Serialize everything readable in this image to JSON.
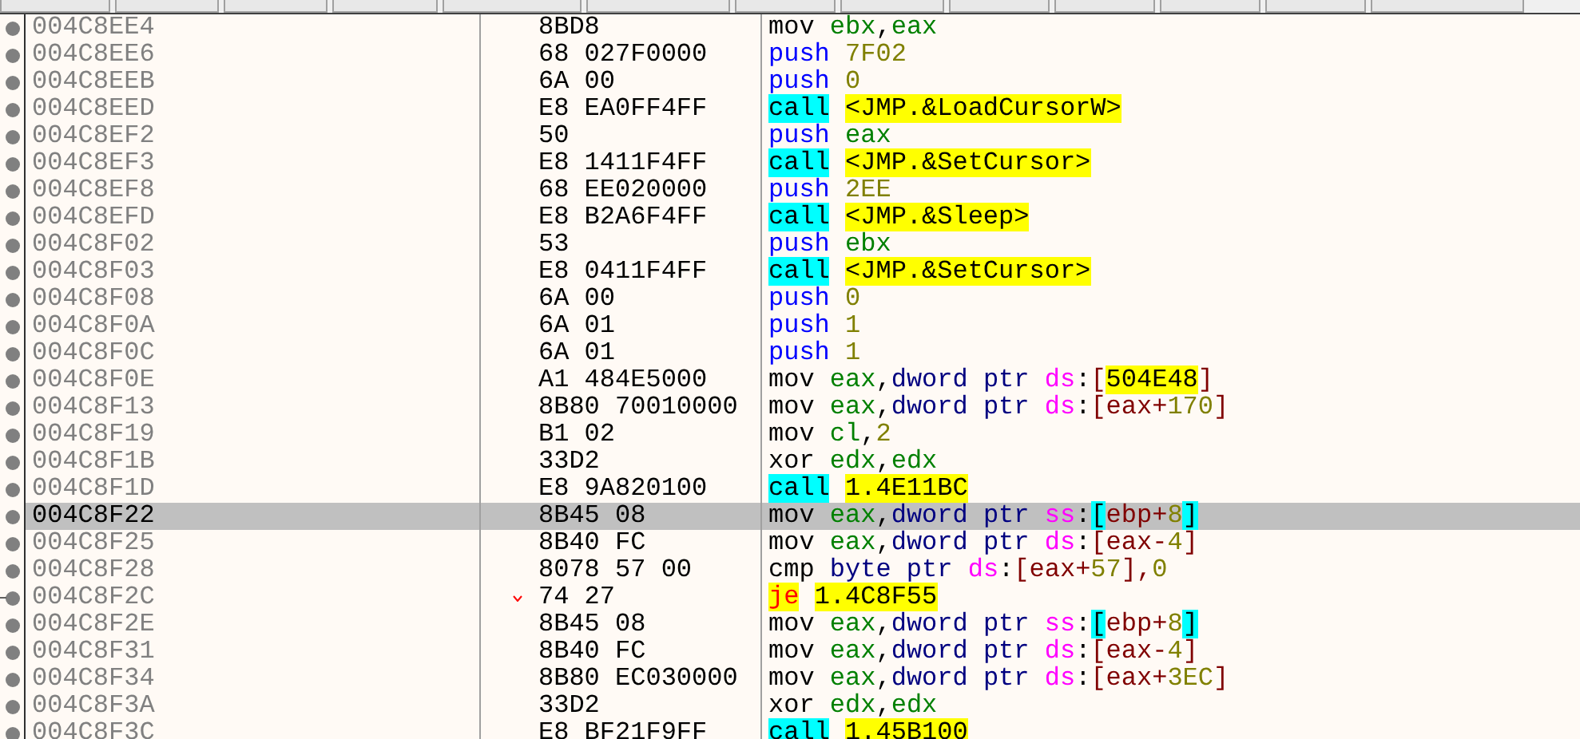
{
  "rows": [
    {
      "address": "004C8EE4",
      "bytes": "8BD8",
      "selected": false,
      "branch": false,
      "ins": [
        {
          "t": "mov",
          "kind": "mnem"
        },
        {
          "t": "ebx",
          "kind": "reg"
        },
        {
          "t": ",",
          "kind": "punct"
        },
        {
          "t": "eax",
          "kind": "reg"
        }
      ]
    },
    {
      "address": "004C8EE6",
      "bytes": "68 027F0000",
      "selected": false,
      "branch": false,
      "ins": [
        {
          "t": "push",
          "kind": "push"
        },
        {
          "t": "7F02",
          "kind": "num"
        }
      ]
    },
    {
      "address": "004C8EEB",
      "bytes": "6A 00",
      "selected": false,
      "branch": false,
      "ins": [
        {
          "t": "push",
          "kind": "push"
        },
        {
          "t": "0",
          "kind": "num"
        }
      ]
    },
    {
      "address": "004C8EED",
      "bytes": "E8 EA0FF4FF",
      "selected": false,
      "branch": false,
      "ins": [
        {
          "t": "call",
          "kind": "call"
        },
        {
          "t": "<JMP.&LoadCursorW>",
          "kind": "target"
        }
      ]
    },
    {
      "address": "004C8EF2",
      "bytes": "50",
      "selected": false,
      "branch": false,
      "ins": [
        {
          "t": "push",
          "kind": "push"
        },
        {
          "t": "eax",
          "kind": "reg"
        }
      ]
    },
    {
      "address": "004C8EF3",
      "bytes": "E8 1411F4FF",
      "selected": false,
      "branch": false,
      "ins": [
        {
          "t": "call",
          "kind": "call"
        },
        {
          "t": "<JMP.&SetCursor>",
          "kind": "target"
        }
      ]
    },
    {
      "address": "004C8EF8",
      "bytes": "68 EE020000",
      "selected": false,
      "branch": false,
      "ins": [
        {
          "t": "push",
          "kind": "push"
        },
        {
          "t": "2EE",
          "kind": "num"
        }
      ]
    },
    {
      "address": "004C8EFD",
      "bytes": "E8 B2A6F4FF",
      "selected": false,
      "branch": false,
      "ins": [
        {
          "t": "call",
          "kind": "call"
        },
        {
          "t": "<JMP.&Sleep>",
          "kind": "target"
        }
      ]
    },
    {
      "address": "004C8F02",
      "bytes": "53",
      "selected": false,
      "branch": false,
      "ins": [
        {
          "t": "push",
          "kind": "push"
        },
        {
          "t": "ebx",
          "kind": "reg"
        }
      ]
    },
    {
      "address": "004C8F03",
      "bytes": "E8 0411F4FF",
      "selected": false,
      "branch": false,
      "ins": [
        {
          "t": "call",
          "kind": "call"
        },
        {
          "t": "<JMP.&SetCursor>",
          "kind": "target"
        }
      ]
    },
    {
      "address": "004C8F08",
      "bytes": "6A 00",
      "selected": false,
      "branch": false,
      "ins": [
        {
          "t": "push",
          "kind": "push"
        },
        {
          "t": "0",
          "kind": "num"
        }
      ]
    },
    {
      "address": "004C8F0A",
      "bytes": "6A 01",
      "selected": false,
      "branch": false,
      "ins": [
        {
          "t": "push",
          "kind": "push"
        },
        {
          "t": "1",
          "kind": "num"
        }
      ]
    },
    {
      "address": "004C8F0C",
      "bytes": "6A 01",
      "selected": false,
      "branch": false,
      "ins": [
        {
          "t": "push",
          "kind": "push"
        },
        {
          "t": "1",
          "kind": "num"
        }
      ]
    },
    {
      "address": "004C8F0E",
      "bytes": "A1 484E5000",
      "selected": false,
      "branch": false,
      "ins": [
        {
          "t": "mov",
          "kind": "mnem"
        },
        {
          "t": "eax",
          "kind": "reg"
        },
        {
          "t": ",",
          "kind": "punct"
        },
        {
          "t": "dword ptr",
          "kind": "size"
        },
        {
          "t": "ds",
          "kind": "seg"
        },
        {
          "t": ":",
          "kind": "punct"
        },
        {
          "t": "[",
          "kind": "op"
        },
        {
          "t": "504E48",
          "kind": "target"
        },
        {
          "t": "]",
          "kind": "op"
        }
      ]
    },
    {
      "address": "004C8F13",
      "bytes": "8B80 70010000",
      "selected": false,
      "branch": false,
      "ins": [
        {
          "t": "mov",
          "kind": "mnem"
        },
        {
          "t": "eax",
          "kind": "reg"
        },
        {
          "t": ",",
          "kind": "punct"
        },
        {
          "t": "dword ptr",
          "kind": "size"
        },
        {
          "t": "ds",
          "kind": "seg"
        },
        {
          "t": ":",
          "kind": "punct"
        },
        {
          "t": "[eax+",
          "kind": "op"
        },
        {
          "t": "170",
          "kind": "num"
        },
        {
          "t": "]",
          "kind": "op"
        }
      ]
    },
    {
      "address": "004C8F19",
      "bytes": "B1 02",
      "selected": false,
      "branch": false,
      "ins": [
        {
          "t": "mov",
          "kind": "mnem"
        },
        {
          "t": "cl",
          "kind": "reg"
        },
        {
          "t": ",",
          "kind": "punct"
        },
        {
          "t": "2",
          "kind": "num"
        }
      ]
    },
    {
      "address": "004C8F1B",
      "bytes": "33D2",
      "selected": false,
      "branch": false,
      "ins": [
        {
          "t": "xor",
          "kind": "mnem"
        },
        {
          "t": "edx",
          "kind": "reg"
        },
        {
          "t": ",",
          "kind": "punct"
        },
        {
          "t": "edx",
          "kind": "reg"
        }
      ]
    },
    {
      "address": "004C8F1D",
      "bytes": "E8 9A820100",
      "selected": false,
      "branch": false,
      "ins": [
        {
          "t": "call",
          "kind": "call"
        },
        {
          "t": "1.4E11BC",
          "kind": "target"
        }
      ]
    },
    {
      "address": "004C8F22",
      "bytes": "8B45 08",
      "selected": true,
      "branch": false,
      "ins": [
        {
          "t": "mov",
          "kind": "mnem"
        },
        {
          "t": "eax",
          "kind": "reg"
        },
        {
          "t": ",",
          "kind": "punct"
        },
        {
          "t": "dword ptr",
          "kind": "size"
        },
        {
          "t": "ss",
          "kind": "seg"
        },
        {
          "t": ":",
          "kind": "punct"
        },
        {
          "t": "[",
          "kind": "brkhl"
        },
        {
          "t": "ebp+",
          "kind": "op"
        },
        {
          "t": "8",
          "kind": "num"
        },
        {
          "t": "]",
          "kind": "brkhl"
        }
      ]
    },
    {
      "address": "004C8F25",
      "bytes": "8B40 FC",
      "selected": false,
      "branch": false,
      "ins": [
        {
          "t": "mov",
          "kind": "mnem"
        },
        {
          "t": "eax",
          "kind": "reg"
        },
        {
          "t": ",",
          "kind": "punct"
        },
        {
          "t": "dword ptr",
          "kind": "size"
        },
        {
          "t": "ds",
          "kind": "seg"
        },
        {
          "t": ":",
          "kind": "punct"
        },
        {
          "t": "[eax-",
          "kind": "op"
        },
        {
          "t": "4",
          "kind": "num"
        },
        {
          "t": "]",
          "kind": "op"
        }
      ]
    },
    {
      "address": "004C8F28",
      "bytes": "8078 57 00",
      "selected": false,
      "branch": false,
      "ins": [
        {
          "t": "cmp",
          "kind": "mnem"
        },
        {
          "t": "byte ptr",
          "kind": "size"
        },
        {
          "t": "ds",
          "kind": "seg"
        },
        {
          "t": ":",
          "kind": "punct"
        },
        {
          "t": "[eax+",
          "kind": "op"
        },
        {
          "t": "57",
          "kind": "num"
        },
        {
          "t": "],",
          "kind": "op"
        },
        {
          "t": "0",
          "kind": "num"
        }
      ]
    },
    {
      "address": "004C8F2C",
      "bytes": "74 27",
      "selected": false,
      "branch": true,
      "ins": [
        {
          "t": "je",
          "kind": "jump"
        },
        {
          "t": "1.4C8F55",
          "kind": "target"
        }
      ]
    },
    {
      "address": "004C8F2E",
      "bytes": "8B45 08",
      "selected": false,
      "branch": false,
      "ins": [
        {
          "t": "mov",
          "kind": "mnem"
        },
        {
          "t": "eax",
          "kind": "reg"
        },
        {
          "t": ",",
          "kind": "punct"
        },
        {
          "t": "dword ptr",
          "kind": "size"
        },
        {
          "t": "ss",
          "kind": "seg"
        },
        {
          "t": ":",
          "kind": "punct"
        },
        {
          "t": "[",
          "kind": "brkhl"
        },
        {
          "t": "ebp+",
          "kind": "op"
        },
        {
          "t": "8",
          "kind": "num"
        },
        {
          "t": "]",
          "kind": "brkhl"
        }
      ]
    },
    {
      "address": "004C8F31",
      "bytes": "8B40 FC",
      "selected": false,
      "branch": false,
      "ins": [
        {
          "t": "mov",
          "kind": "mnem"
        },
        {
          "t": "eax",
          "kind": "reg"
        },
        {
          "t": ",",
          "kind": "punct"
        },
        {
          "t": "dword ptr",
          "kind": "size"
        },
        {
          "t": "ds",
          "kind": "seg"
        },
        {
          "t": ":",
          "kind": "punct"
        },
        {
          "t": "[eax-",
          "kind": "op"
        },
        {
          "t": "4",
          "kind": "num"
        },
        {
          "t": "]",
          "kind": "op"
        }
      ]
    },
    {
      "address": "004C8F34",
      "bytes": "8B80 EC030000",
      "selected": false,
      "branch": false,
      "ins": [
        {
          "t": "mov",
          "kind": "mnem"
        },
        {
          "t": "eax",
          "kind": "reg"
        },
        {
          "t": ",",
          "kind": "punct"
        },
        {
          "t": "dword ptr",
          "kind": "size"
        },
        {
          "t": "ds",
          "kind": "seg"
        },
        {
          "t": ":",
          "kind": "punct"
        },
        {
          "t": "[eax+",
          "kind": "op"
        },
        {
          "t": "3EC",
          "kind": "num"
        },
        {
          "t": "]",
          "kind": "op"
        }
      ]
    },
    {
      "address": "004C8F3A",
      "bytes": "33D2",
      "selected": false,
      "branch": false,
      "ins": [
        {
          "t": "xor",
          "kind": "mnem"
        },
        {
          "t": "edx",
          "kind": "reg"
        },
        {
          "t": ",",
          "kind": "punct"
        },
        {
          "t": "edx",
          "kind": "reg"
        }
      ]
    },
    {
      "address": "004C8F3C",
      "bytes": "E8 BF21F9FF",
      "selected": false,
      "branch": false,
      "ins": [
        {
          "t": "call",
          "kind": "call"
        },
        {
          "t": "1.45B100",
          "kind": "target"
        }
      ]
    }
  ]
}
